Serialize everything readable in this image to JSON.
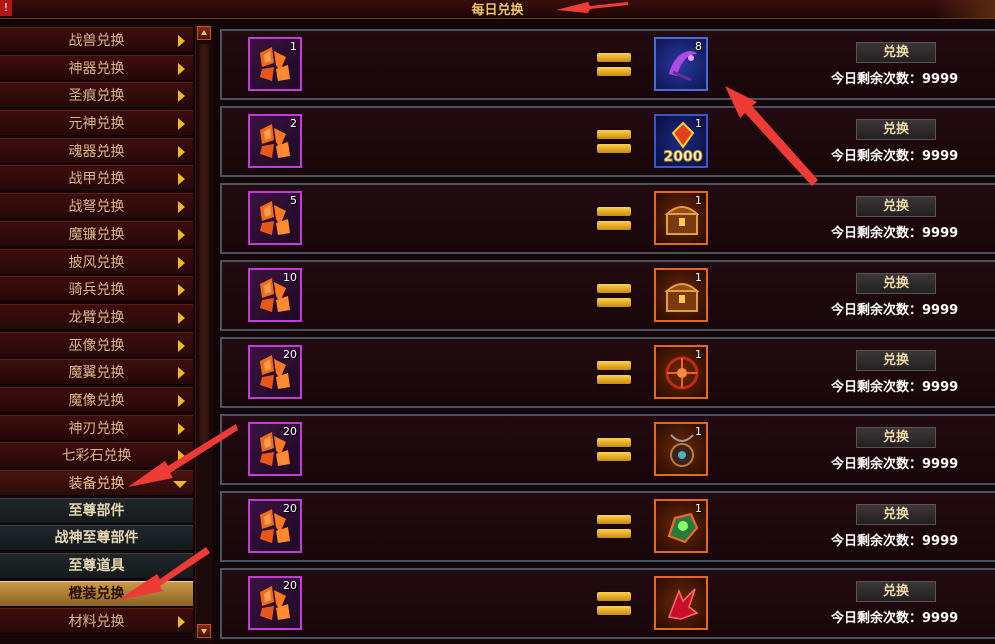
{
  "header": {
    "title": "每日兑换",
    "error_badge": "!"
  },
  "sidebar": {
    "items": [
      {
        "label": "战兽兑换"
      },
      {
        "label": "神器兑换"
      },
      {
        "label": "圣痕兑换"
      },
      {
        "label": "元神兑换"
      },
      {
        "label": "魂器兑换"
      },
      {
        "label": "战甲兑换"
      },
      {
        "label": "战弩兑换"
      },
      {
        "label": "魔镰兑换"
      },
      {
        "label": "披风兑换"
      },
      {
        "label": "骑兵兑换"
      },
      {
        "label": "龙臂兑换"
      },
      {
        "label": "巫像兑换"
      },
      {
        "label": "魔翼兑换"
      },
      {
        "label": "魔像兑换"
      },
      {
        "label": "神刃兑换"
      },
      {
        "label": "七彩石兑换"
      }
    ],
    "open_item": {
      "label": "装备兑换"
    },
    "sub_items": [
      {
        "label": "至尊部件"
      },
      {
        "label": "战神至尊部件"
      },
      {
        "label": "至尊道具"
      },
      {
        "label": "橙装兑换",
        "active": true
      }
    ],
    "bottom_item": {
      "label": "材料兑换"
    }
  },
  "rows": [
    {
      "src_qty": "1",
      "dst_qty": "8",
      "dst_icon": "purple-scythe-icon",
      "dst_style": "blue",
      "button": "兑换",
      "remain_label": "今日剩余次数：",
      "remain_value": "9999"
    },
    {
      "src_qty": "2",
      "dst_qty": "1",
      "dst_icon": "gem-2000-icon",
      "dst_style": "gold",
      "dst_text": "2000",
      "button": "兑换",
      "remain_label": "今日剩余次数：",
      "remain_value": "9999"
    },
    {
      "src_qty": "5",
      "dst_qty": "1",
      "dst_icon": "treasure-chest-icon",
      "dst_style": "orange",
      "button": "兑换",
      "remain_label": "今日剩余次数：",
      "remain_value": "9999"
    },
    {
      "src_qty": "10",
      "dst_qty": "1",
      "dst_icon": "treasure-chest-icon",
      "dst_style": "orange",
      "button": "兑换",
      "remain_label": "今日剩余次数：",
      "remain_value": "9999"
    },
    {
      "src_qty": "20",
      "dst_qty": "1",
      "dst_icon": "red-rune-orb-icon",
      "dst_style": "orange",
      "button": "兑换",
      "remain_label": "今日剩余次数：",
      "remain_value": "9999"
    },
    {
      "src_qty": "20",
      "dst_qty": "1",
      "dst_icon": "dark-amulet-icon",
      "dst_style": "orange",
      "button": "兑换",
      "remain_label": "今日剩余次数：",
      "remain_value": "9999"
    },
    {
      "src_qty": "20",
      "dst_qty": "1",
      "dst_icon": "green-gauntlet-icon",
      "dst_style": "orange",
      "button": "兑换",
      "remain_label": "今日剩余次数：",
      "remain_value": "9999"
    },
    {
      "src_qty": "20",
      "dst_qty": "",
      "dst_icon": "red-dragon-emblem-icon",
      "dst_style": "orange",
      "button": "兑换",
      "remain_label": "今日剩余次数：",
      "remain_value": "9999"
    }
  ],
  "colors": {
    "accent": "#f1b821",
    "annotation_arrow": "#e8403a",
    "frame": "#4a5260"
  }
}
